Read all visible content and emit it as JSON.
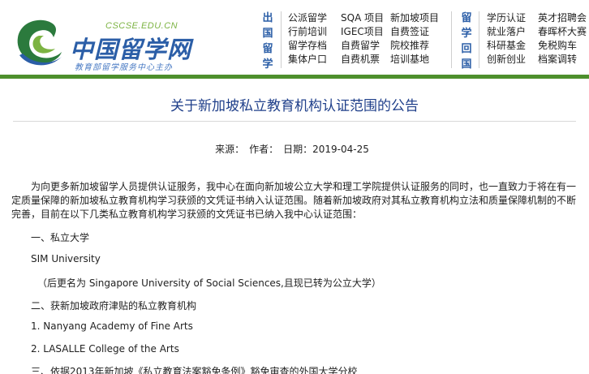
{
  "header": {
    "logo_url": "CSCSE.EDU.CN",
    "logo_cn": "中国留学网",
    "logo_sub": "教育部留学服务中心主办",
    "section1_title": [
      "出",
      "国",
      "留",
      "学"
    ],
    "section1_col1": [
      "公派留学",
      "行前培训",
      "留学存档",
      "集体户口"
    ],
    "section1_col2": [
      "SQA 项目",
      "IGEC项目",
      "自费留学",
      "自费机票"
    ],
    "section1_col3": [
      "新加坡项目",
      "自费签证",
      "院校推荐",
      "培训基地"
    ],
    "section2_title": [
      "留",
      "学",
      "回",
      "国"
    ],
    "section2_col1": [
      "学历认证",
      "就业落户",
      "科研基金",
      "创新创业"
    ],
    "section2_col2": [
      "英才招聘会",
      "春晖杯大赛",
      "免税购车",
      "档案调转"
    ]
  },
  "article": {
    "title": "关于新加坡私立教育机构认证范围的公告",
    "meta_source": "来源：",
    "meta_author": "作者：",
    "meta_date": "日期：2019-04-25",
    "intro": "为向更多新加坡留学人员提供认证服务，我中心在面向新加坡公立大学和理工学院提供认证服务的同时，也一直致力于将在有一定质量保障的新加坡私立教育机构学习获颁的文凭证书纳入认证范围。随着新加坡政府对其私立教育机构立法和质量保障机制的不断完善，目前在以下几类私立教育机构学习获颁的文凭证书已纳入我中心认证范围：",
    "lines": [
      "一、私立大学",
      "SIM University",
      "（后更名为 Singapore University of Social Sciences,且现已转为公立大学）",
      "二、获新加坡政府津贴的私立教育机构",
      "1.  Nanyang Academy of Fine Arts",
      "2.  LASALLE College of the Arts",
      "三、依据2013年新加坡《私立教育法案豁免条例》豁免审查的外国大学分校"
    ]
  },
  "colors": {
    "brand_blue": "#2b5ea7",
    "brand_green": "#4d8f2c",
    "title_blue": "#1f3f8a"
  }
}
